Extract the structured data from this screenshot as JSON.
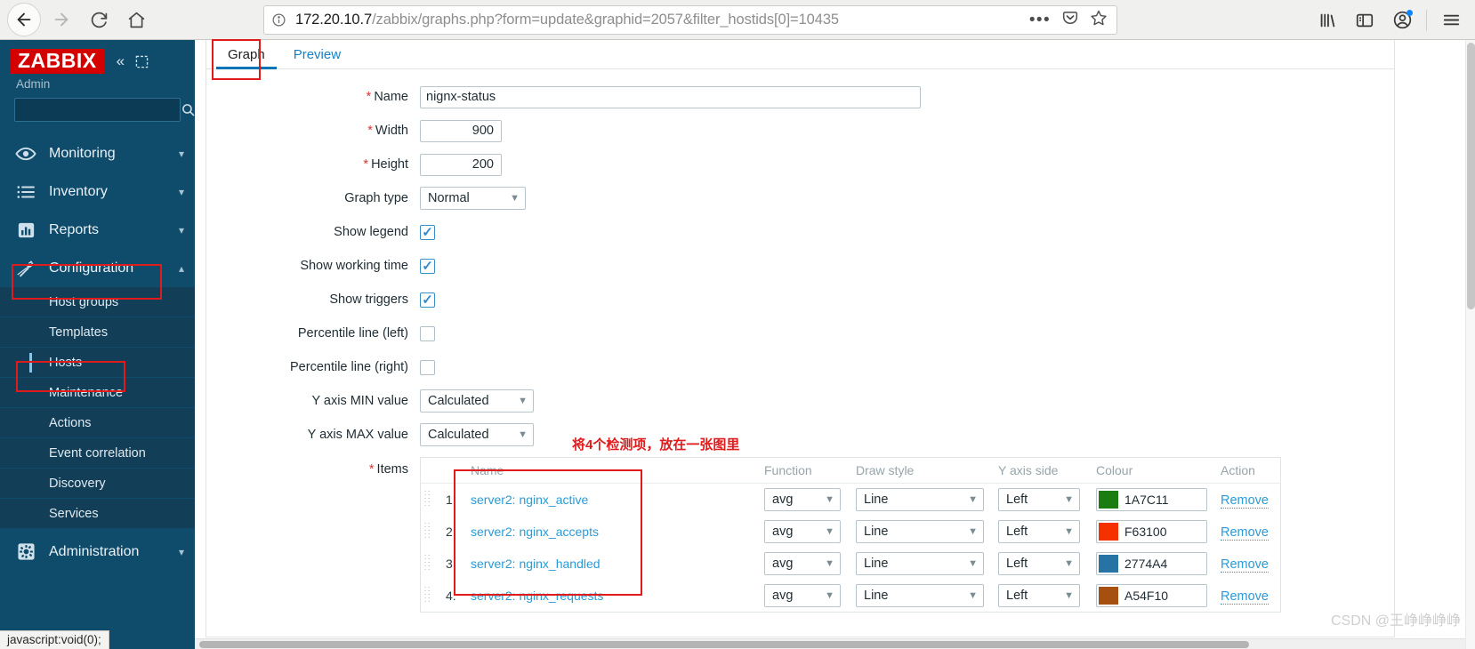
{
  "browser": {
    "url_host": "172.20.10.7",
    "url_path": "/zabbix/graphs.php?form=update&graphid=2057&filter_hostids[0]=10435",
    "status_tip": "javascript:void(0);"
  },
  "sidebar": {
    "logo": "ZABBIX",
    "user": "Admin",
    "search_value": "",
    "search_placeholder": "",
    "items": [
      {
        "label": "Monitoring",
        "icon": "eye-icon"
      },
      {
        "label": "Inventory",
        "icon": "list-icon"
      },
      {
        "label": "Reports",
        "icon": "bar-chart-icon"
      },
      {
        "label": "Configuration",
        "icon": "wrench-icon"
      }
    ],
    "submenu": [
      "Host groups",
      "Templates",
      "Hosts",
      "Maintenance",
      "Actions",
      "Event correlation",
      "Discovery",
      "Services"
    ],
    "selected_sub": "Hosts",
    "administration": {
      "label": "Administration",
      "icon": "gear-icon"
    }
  },
  "tabs": [
    {
      "label": "Graph",
      "active": true
    },
    {
      "label": "Preview",
      "active": false
    }
  ],
  "form": {
    "name": {
      "label": "Name",
      "value": "nignx-status",
      "required": true
    },
    "width": {
      "label": "Width",
      "value": "900",
      "required": true
    },
    "height": {
      "label": "Height",
      "value": "200",
      "required": true
    },
    "graph_type": {
      "label": "Graph type",
      "value": "Normal"
    },
    "show_legend": {
      "label": "Show legend",
      "checked": true
    },
    "show_working_time": {
      "label": "Show working time",
      "checked": true
    },
    "show_triggers": {
      "label": "Show triggers",
      "checked": true
    },
    "percentile_left": {
      "label": "Percentile line (left)",
      "checked": false
    },
    "percentile_right": {
      "label": "Percentile line (right)",
      "checked": false
    },
    "y_axis_min": {
      "label": "Y axis MIN value",
      "value": "Calculated"
    },
    "y_axis_max": {
      "label": "Y axis MAX value",
      "value": "Calculated"
    },
    "items_label": "Items",
    "items_required": true
  },
  "items_table": {
    "headers": [
      "Name",
      "Function",
      "Draw style",
      "Y axis side",
      "Colour",
      "Action"
    ],
    "rows": [
      {
        "index": "1:",
        "name": "server2: nginx_active",
        "function": "avg",
        "draw_style": "Line",
        "y_axis_side": "Left",
        "colour": "1A7C11",
        "colour_hex": "#1A7C11",
        "action": "Remove"
      },
      {
        "index": "2:",
        "name": "server2: nginx_accepts",
        "function": "avg",
        "draw_style": "Line",
        "y_axis_side": "Left",
        "colour": "F63100",
        "colour_hex": "#F63100",
        "action": "Remove"
      },
      {
        "index": "3:",
        "name": "server2: nginx_handled",
        "function": "avg",
        "draw_style": "Line",
        "y_axis_side": "Left",
        "colour": "2774A4",
        "colour_hex": "#2774A4",
        "action": "Remove"
      },
      {
        "index": "4:",
        "name": "server2: nginx_requests",
        "function": "avg",
        "draw_style": "Line",
        "y_axis_side": "Left",
        "colour": "A54F10",
        "colour_hex": "#A54F10",
        "action": "Remove"
      }
    ]
  },
  "annotations": {
    "items_note": "将4个检测项，放在一张图里",
    "accent_red": "#e01b1b"
  },
  "watermark": "CSDN @王峥峥峥峥"
}
